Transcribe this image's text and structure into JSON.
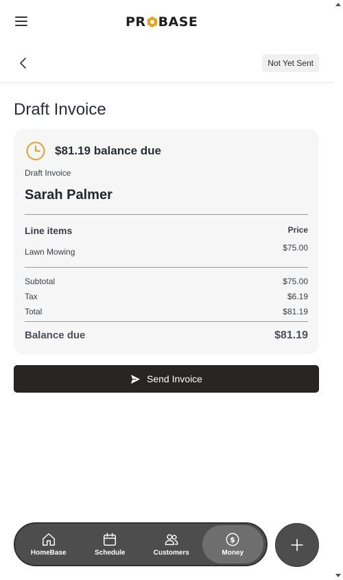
{
  "header": {
    "logo_text_left": "PR",
    "logo_text_right": "BASE",
    "logo_hex_color": "#f2a20e"
  },
  "subheader": {
    "status_badge": "Not Yet Sent"
  },
  "page": {
    "title": "Draft Invoice"
  },
  "invoice": {
    "balance_heading": "$81.19 balance due",
    "type_label": "Draft Invoice",
    "customer_name": "Sarah Palmer",
    "line_items_header": "Line items",
    "price_header": "Price",
    "line_items": [
      {
        "name": "Lawn Mowing",
        "price": "$75.00"
      }
    ],
    "subtotal_label": "Subtotal",
    "subtotal_value": "$75.00",
    "tax_label": "Tax",
    "tax_value": "$6.19",
    "total_label": "Total",
    "total_value": "$81.19",
    "balance_label": "Balance due",
    "balance_value": "$81.19",
    "accent_color": "#e8a020"
  },
  "actions": {
    "send_label": "Send Invoice"
  },
  "nav": {
    "items": [
      {
        "label": "HomeBase",
        "icon": "home-icon"
      },
      {
        "label": "Schedule",
        "icon": "calendar-icon"
      },
      {
        "label": "Customers",
        "icon": "users-icon"
      },
      {
        "label": "Money",
        "icon": "dollar-circle-icon",
        "active": true
      }
    ],
    "fab_icon": "plus-icon"
  }
}
